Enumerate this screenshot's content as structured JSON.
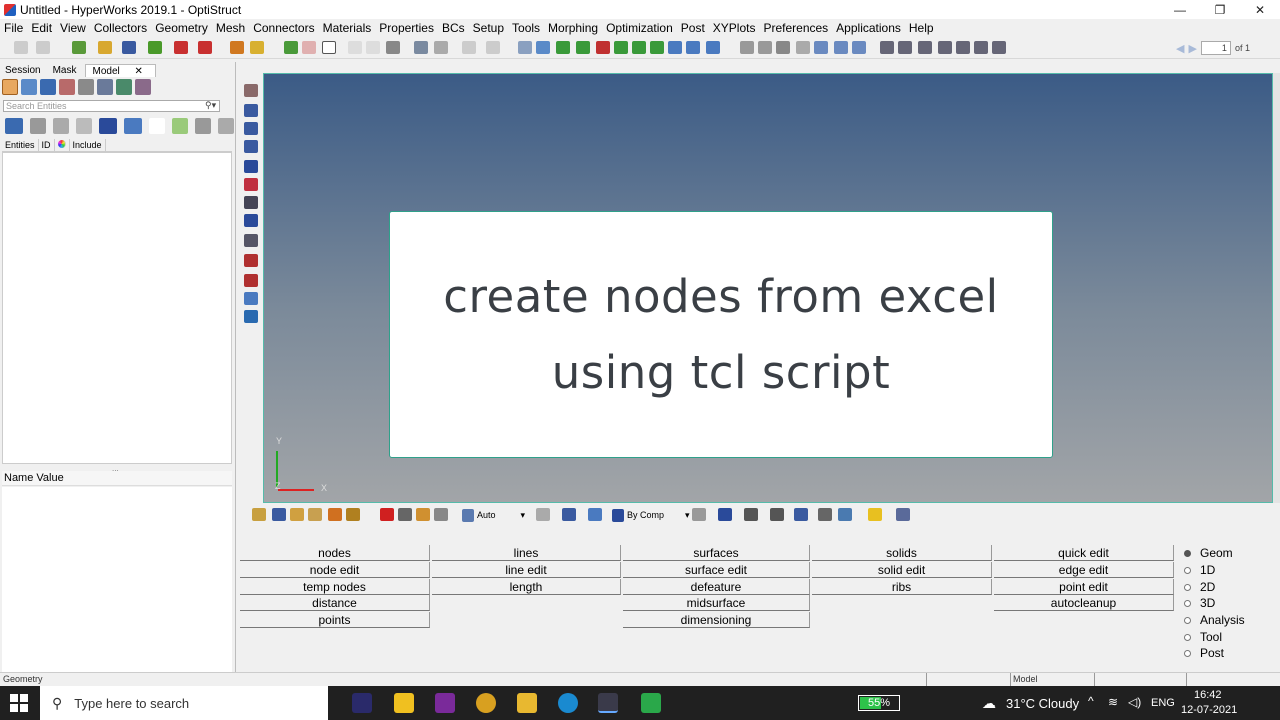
{
  "window": {
    "title": "Untitled - HyperWorks 2019.1 - OptiStruct",
    "minimize": "—",
    "maximize": "❐",
    "close": "✕"
  },
  "menu": [
    "File",
    "Edit",
    "View",
    "Collectors",
    "Geometry",
    "Mesh",
    "Connectors",
    "Materials",
    "Properties",
    "BCs",
    "Setup",
    "Tools",
    "Morphing",
    "Optimization",
    "Post",
    "XYPlots",
    "Preferences",
    "Applications",
    "Help"
  ],
  "toolbar": {
    "page_value": "1",
    "page_of": "of 1"
  },
  "left_panel": {
    "tabs": [
      "Session",
      "Mask",
      "Model"
    ],
    "active_tab": "Model",
    "tab_close": "✕",
    "search_placeholder": "Search Entities",
    "columns": [
      "Entities",
      "ID",
      "",
      "Include"
    ],
    "splitter": "...",
    "name_value_header": "Name Value"
  },
  "graphics": {
    "title_line1": "create nodes from excel",
    "title_line2": "using tcl script",
    "axis_y": "Y",
    "axis_z": "Z",
    "axis_x": "X"
  },
  "bottom_toolbar": {
    "auto_combo": "Auto",
    "color_combo": "By Comp"
  },
  "utility_menu": {
    "columns": [
      [
        "nodes",
        "node edit",
        "temp nodes",
        "distance",
        "points"
      ],
      [
        "lines",
        "line edit",
        "length"
      ],
      [
        "surfaces",
        "surface edit",
        "defeature",
        "midsurface",
        "dimensioning"
      ],
      [
        "solids",
        "solid edit",
        "ribs"
      ],
      [
        "quick edit",
        "edge edit",
        "point edit",
        "autocleanup"
      ]
    ],
    "radio_options": [
      "Geom",
      "1D",
      "2D",
      "3D",
      "Analysis",
      "Tool",
      "Post"
    ],
    "radio_selected": "Geom"
  },
  "status_bar": {
    "left": "Geometry",
    "model_field": "Model"
  },
  "taskbar": {
    "search_text": "Type here to search",
    "battery_percent": 55,
    "battery_label": "55%",
    "weather": "31°C  Cloudy",
    "language": "ENG",
    "time": "16:42",
    "date": "12-07-2021"
  },
  "colors": {
    "graphics_top": "#3b5b86",
    "graphics_bottom": "#a2a5a8",
    "card_border": "#2fa08a",
    "taskbar": "#202020",
    "battery": "#2ec24a"
  }
}
